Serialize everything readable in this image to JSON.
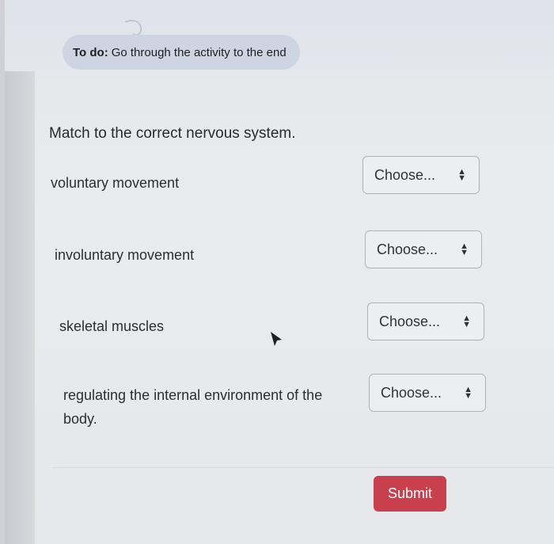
{
  "todo": {
    "label": "To do:",
    "text": "Go through the activity to the end"
  },
  "question": "Match to the correct nervous system.",
  "rows": [
    {
      "label": "voluntary movement",
      "select": "Choose..."
    },
    {
      "label": "involuntary movement",
      "select": "Choose..."
    },
    {
      "label": "skeletal muscles",
      "select": "Choose..."
    },
    {
      "label": "regulating the internal environment of the body.",
      "select": "Choose..."
    }
  ],
  "submit_label": "Submit",
  "colors": {
    "submit": "#c8404e",
    "todo_pill": "#cdd5e2"
  },
  "icons": {
    "select_arrow": "up-down-arrows-icon",
    "pointer": "mouse-pointer-icon"
  }
}
